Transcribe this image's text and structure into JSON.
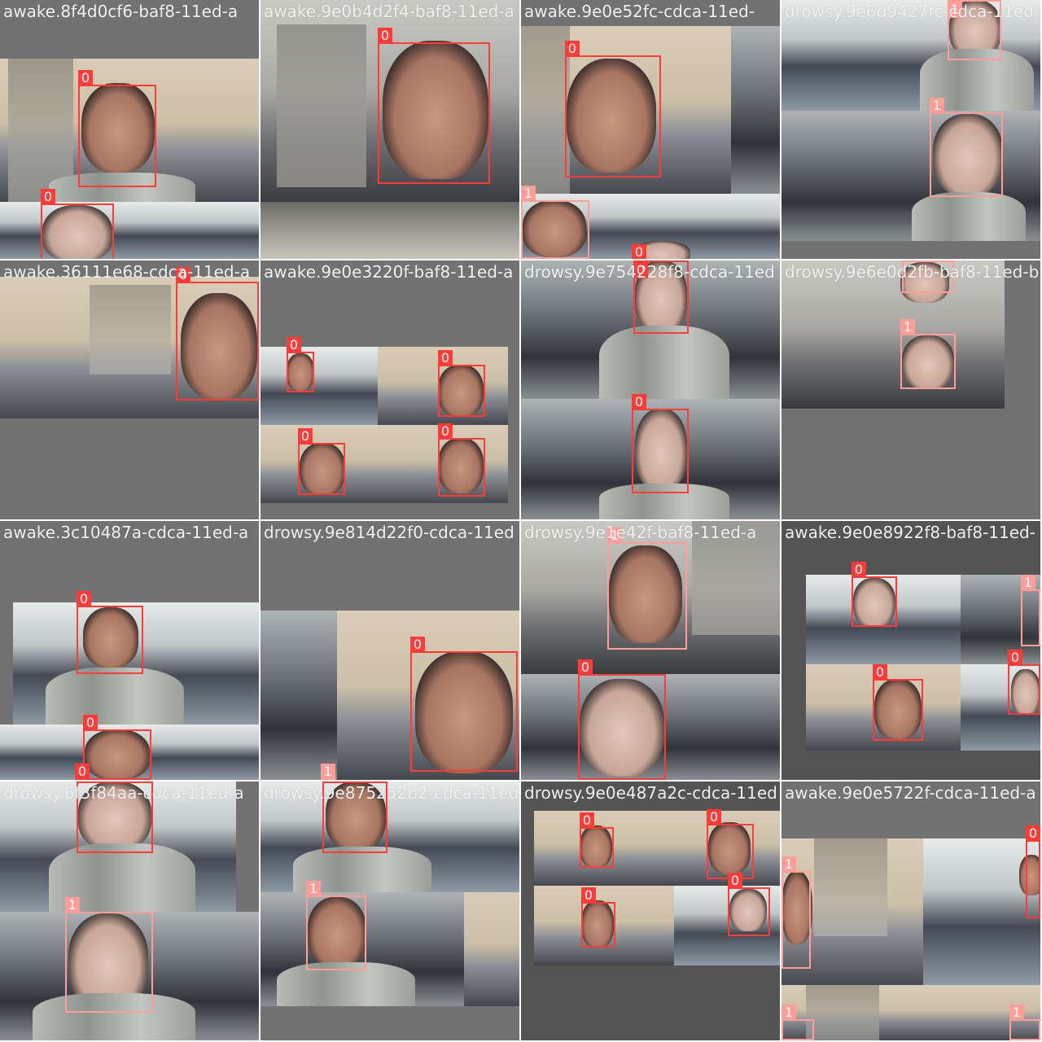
{
  "colors": {
    "class0": "#ff3b38",
    "class1": "#ff9d97",
    "tile_background": "#727272",
    "label_text": "#f2f2f2"
  },
  "tiles": [
    {
      "file_label": "awake.8f4d0cf6-baf8-11ed-a",
      "boxes": [
        {
          "cls": "0"
        },
        {
          "cls": "0"
        }
      ]
    },
    {
      "file_label": "awake.9e0b4d2f4-baf8-11ed-a",
      "boxes": [
        {
          "cls": "0"
        }
      ]
    },
    {
      "file_label": "awake.9e0e52fc-cdca-11ed-",
      "boxes": [
        {
          "cls": "0"
        },
        {
          "cls": "1"
        },
        {
          "cls": "0"
        }
      ]
    },
    {
      "file_label": "drowsy.9e6d9427fc-cdca-11ed",
      "boxes": [
        {
          "cls": "1"
        },
        {
          "cls": "1"
        }
      ]
    },
    {
      "file_label": "awake.36111e68-cdca-11ed-a",
      "boxes": [
        {
          "cls": "0"
        }
      ]
    },
    {
      "file_label": "awake.9e0e3220f-baf8-11ed-a",
      "boxes": [
        {
          "cls": "0"
        },
        {
          "cls": "0"
        },
        {
          "cls": "0"
        },
        {
          "cls": "0"
        }
      ]
    },
    {
      "file_label": "drowsy.9e754228f8-cdca-11ed",
      "boxes": [
        {
          "cls": "0"
        },
        {
          "cls": "0"
        }
      ]
    },
    {
      "file_label": "drowsy.9e6e0d2fb-baf8-11ed-b",
      "boxes": [
        {
          "cls": "1"
        },
        {
          "cls": "1"
        }
      ]
    },
    {
      "file_label": "awake.3c10487a-cdca-11ed-a",
      "boxes": [
        {
          "cls": "0"
        },
        {
          "cls": "0"
        },
        {
          "cls": "0"
        }
      ]
    },
    {
      "file_label": "drowsy.9e814d22f0-cdca-11ed",
      "boxes": [
        {
          "cls": "0"
        },
        {
          "cls": "1"
        }
      ]
    },
    {
      "file_label": "drowsy.9e1e42f-baf8-11ed-a",
      "boxes": [
        {
          "cls": "1"
        },
        {
          "cls": "0"
        }
      ]
    },
    {
      "file_label": "awake.9e0e8922f8-baf8-11ed-",
      "boxes": [
        {
          "cls": "0"
        },
        {
          "cls": "1"
        },
        {
          "cls": "0"
        },
        {
          "cls": "0"
        }
      ]
    },
    {
      "file_label": "drowsy.6f3f84aa-cdca-11ed-a",
      "boxes": [
        {
          "cls": "0"
        },
        {
          "cls": "1"
        }
      ]
    },
    {
      "file_label": "drowsy.9e875252b2-cdca-11ed",
      "boxes": [
        {
          "cls": "0"
        },
        {
          "cls": "1"
        }
      ]
    },
    {
      "file_label": "drowsy.9e0e487a2c-cdca-11ed",
      "boxes": [
        {
          "cls": "0"
        },
        {
          "cls": "0"
        },
        {
          "cls": "0"
        },
        {
          "cls": "0"
        }
      ]
    },
    {
      "file_label": "awake.9e0e5722f-cdca-11ed-a",
      "boxes": [
        {
          "cls": "0"
        },
        {
          "cls": "1"
        },
        {
          "cls": "1"
        },
        {
          "cls": "1"
        }
      ]
    }
  ]
}
